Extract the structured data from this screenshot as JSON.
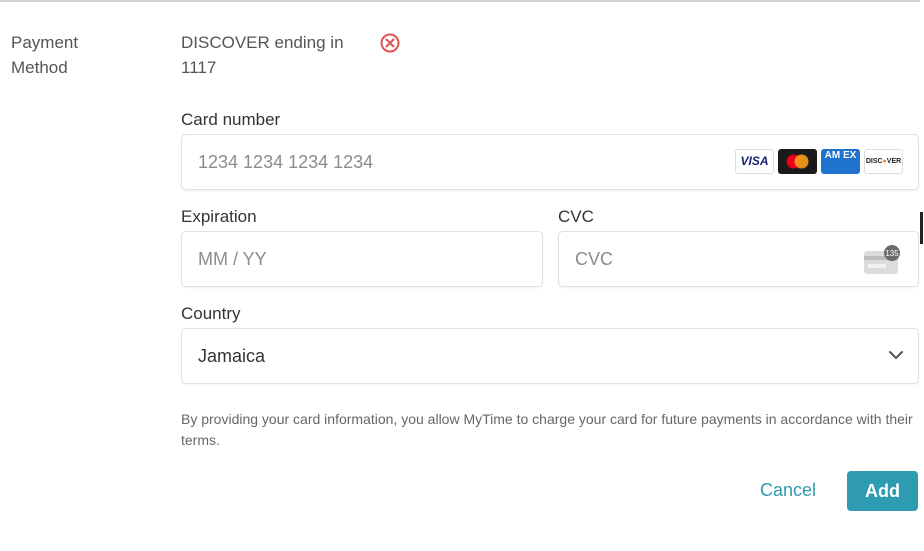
{
  "payment": {
    "section_label": "Payment Method",
    "existing_card": "DISCOVER ending in 1117"
  },
  "card_number": {
    "label": "Card number",
    "placeholder": "1234 1234 1234 1234",
    "brands": [
      {
        "name": "visa-icon",
        "text": "VISA"
      },
      {
        "name": "mastercard-icon",
        "text": ""
      },
      {
        "name": "amex-icon",
        "text": "AM EX"
      },
      {
        "name": "discover-icon",
        "text": "DISCOVER"
      }
    ]
  },
  "expiration": {
    "label": "Expiration",
    "placeholder": "MM / YY"
  },
  "cvc": {
    "label": "CVC",
    "placeholder": "CVC",
    "icon_badge": "135"
  },
  "country": {
    "label": "Country",
    "value": "Jamaica"
  },
  "consent_text": "By providing your card information, you allow MyTime to charge your card for future payments in accordance with their terms.",
  "actions": {
    "cancel_label": "Cancel",
    "add_label": "Add"
  },
  "colors": {
    "accent": "#2e9bb0",
    "remove": "#e05252"
  }
}
